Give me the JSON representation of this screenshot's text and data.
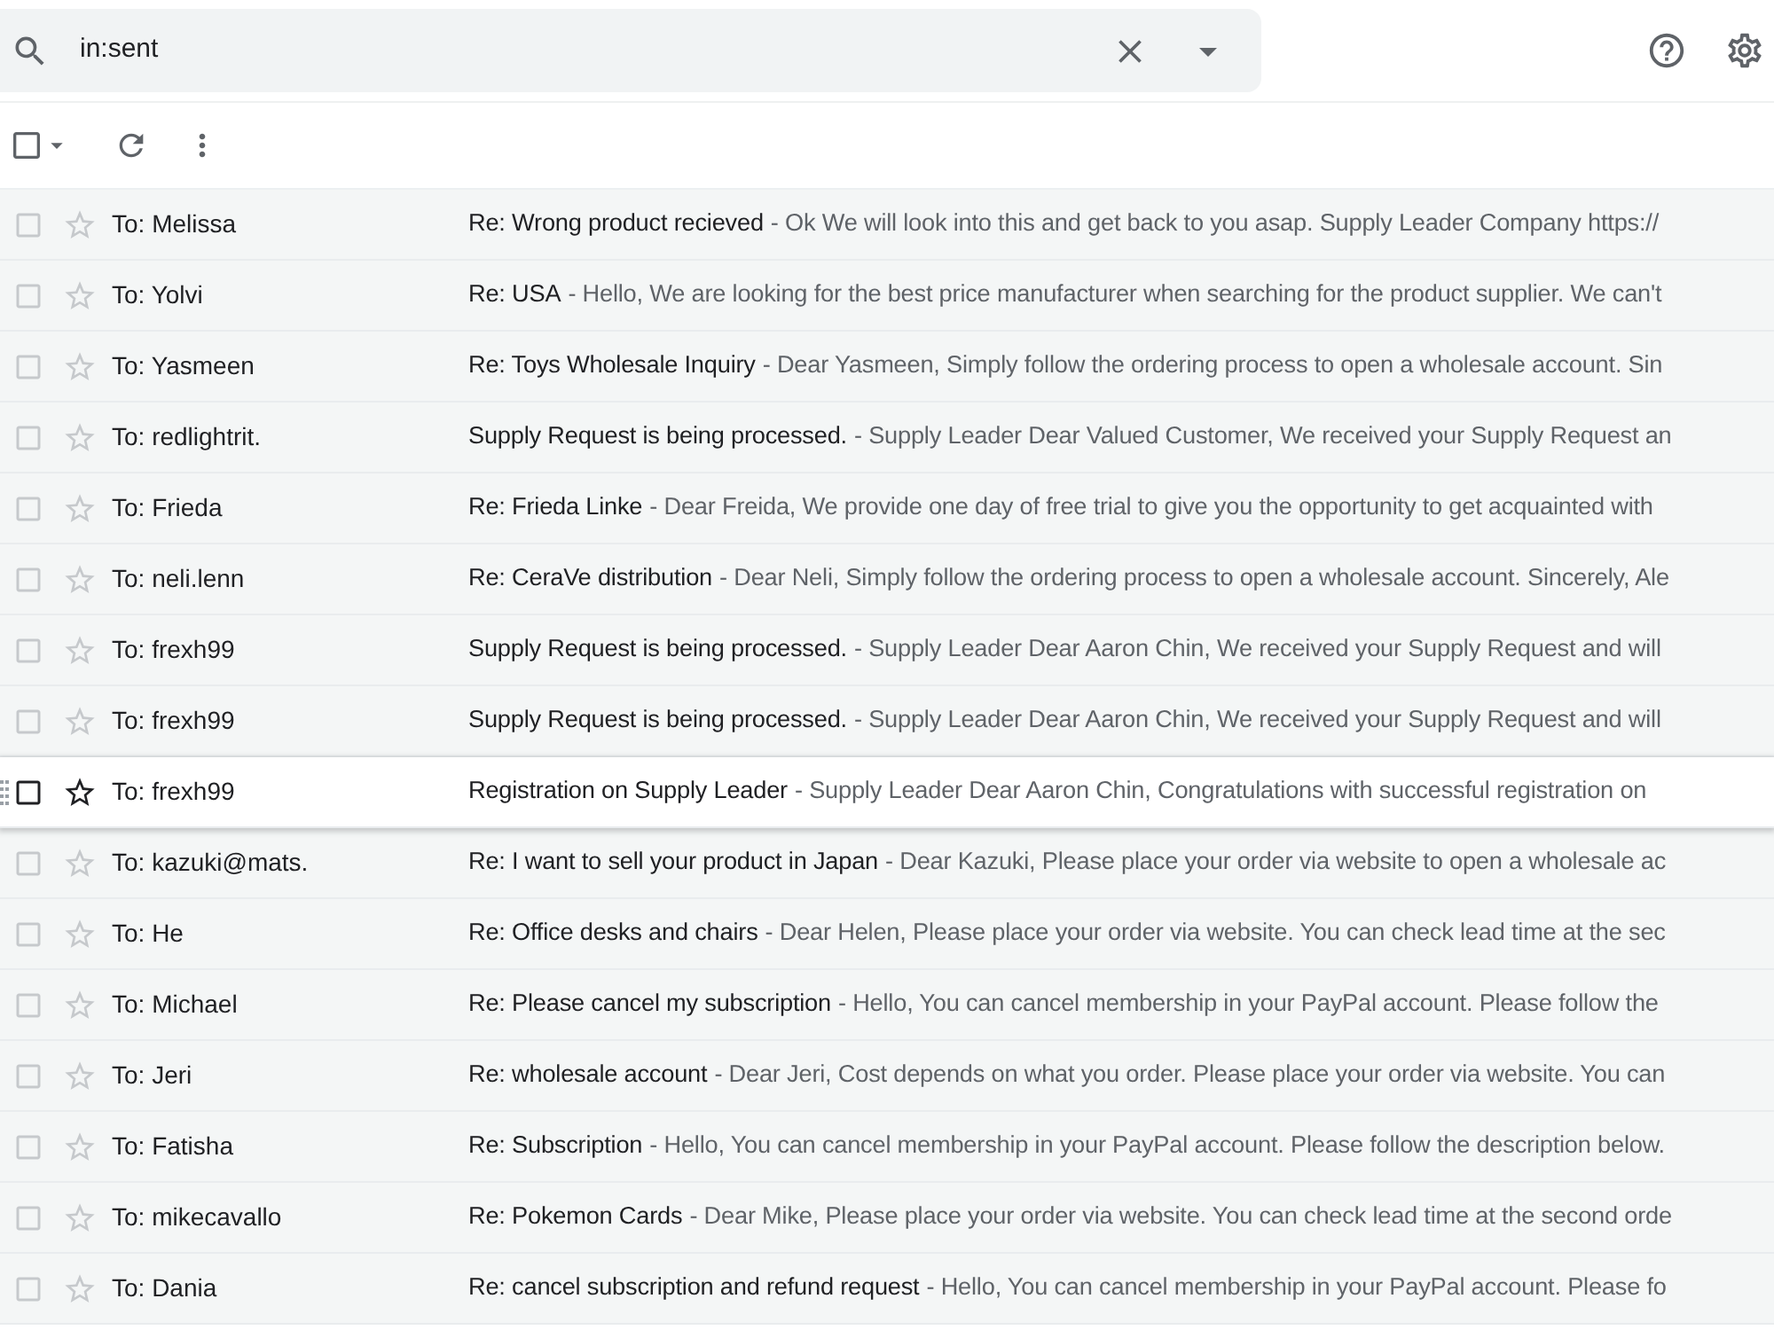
{
  "search": {
    "value": "in:sent"
  },
  "toolbar": {
    "select_all": {
      "checked": false
    }
  },
  "emails": [
    {
      "recipient": "To: Melissa",
      "subject": "Re: Wrong product recieved",
      "snippet": "- Ok We will look into this and get back to you asap. Supply Leader Company https://",
      "checked": false,
      "starred": false,
      "unread": false,
      "hovered": false
    },
    {
      "recipient": "To: Yolvi",
      "subject": "Re: USA",
      "snippet": "- Hello, We are looking for the best price manufacturer when searching for the product supplier. We can't",
      "checked": false,
      "starred": false,
      "unread": false,
      "hovered": false
    },
    {
      "recipient": "To: Yasmeen",
      "subject": "Re: Toys Wholesale Inquiry",
      "snippet": "- Dear Yasmeen, Simply follow the ordering process to open a wholesale account. Sin",
      "checked": false,
      "starred": false,
      "unread": false,
      "hovered": false
    },
    {
      "recipient": "To: redlightrit.",
      "subject": "Supply Request is being processed.",
      "snippet": "- Supply Leader Dear Valued Customer, We received your Supply Request an",
      "checked": false,
      "starred": false,
      "unread": false,
      "hovered": false
    },
    {
      "recipient": "To: Frieda",
      "subject": "Re: Frieda Linke",
      "snippet": "- Dear Freida, We provide one day of free trial to give you the opportunity to get acquainted with",
      "checked": false,
      "starred": false,
      "unread": false,
      "hovered": false
    },
    {
      "recipient": "To: neli.lenn",
      "subject": "Re: CeraVe distribution",
      "snippet": "- Dear Neli, Simply follow the ordering process to open a wholesale account. Sincerely, Ale",
      "checked": false,
      "starred": false,
      "unread": false,
      "hovered": false
    },
    {
      "recipient": "To: frexh99",
      "subject": "Supply Request is being processed.",
      "snippet": "- Supply Leader Dear Aaron Chin, We received your Supply Request and will",
      "checked": false,
      "starred": false,
      "unread": false,
      "hovered": false
    },
    {
      "recipient": "To: frexh99",
      "subject": "Supply Request is being processed.",
      "snippet": "- Supply Leader Dear Aaron Chin, We received your Supply Request and will",
      "checked": false,
      "starred": false,
      "unread": false,
      "hovered": false
    },
    {
      "recipient": "To: frexh99",
      "subject": "Registration on Supply Leader",
      "snippet": "- Supply Leader Dear Aaron Chin, Congratulations with successful registration on",
      "checked": false,
      "starred": false,
      "unread": false,
      "hovered": true
    },
    {
      "recipient": "To: kazuki@mats.",
      "subject": "Re: I want to sell your product in Japan",
      "snippet": "- Dear Kazuki, Please place your order via website to open a wholesale ac",
      "checked": false,
      "starred": false,
      "unread": false,
      "hovered": false
    },
    {
      "recipient": "To: He",
      "subject": "Re: Office desks and chairs",
      "snippet": "- Dear Helen, Please place your order via website. You can check lead time at the sec",
      "checked": false,
      "starred": false,
      "unread": false,
      "hovered": false
    },
    {
      "recipient": "To: Michael",
      "subject": "Re: Please cancel my subscription",
      "snippet": "- Hello, You can cancel membership in your PayPal account. Please follow the",
      "checked": false,
      "starred": false,
      "unread": false,
      "hovered": false
    },
    {
      "recipient": "To: Jeri",
      "subject": "Re: wholesale account",
      "snippet": "- Dear Jeri, Cost depends on what you order. Please place your order via website. You can",
      "checked": false,
      "starred": false,
      "unread": false,
      "hovered": false
    },
    {
      "recipient": "To: Fatisha",
      "subject": "Re: Subscription",
      "snippet": "- Hello, You can cancel membership in your PayPal account. Please follow the description below.",
      "checked": false,
      "starred": false,
      "unread": false,
      "hovered": false
    },
    {
      "recipient": "To: mikecavallo",
      "subject": "Re: Pokemon Cards",
      "snippet": "- Dear Mike, Please place your order via website. You can check lead time at the second orde",
      "checked": false,
      "starred": false,
      "unread": false,
      "hovered": false
    },
    {
      "recipient": "To: Dania",
      "subject": "Re: cancel subscription and refund request",
      "snippet": "- Hello, You can cancel membership in your PayPal account. Please fo",
      "checked": false,
      "starred": false,
      "unread": false,
      "hovered": false
    }
  ]
}
